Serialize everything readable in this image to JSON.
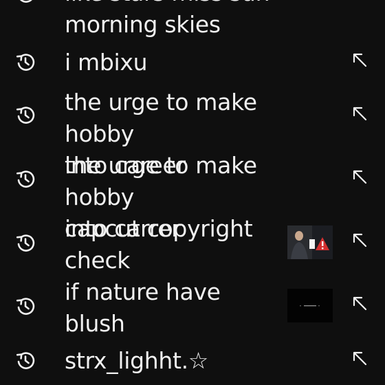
{
  "search_history": [
    {
      "query": "like stars miss sun\nmorning skies",
      "has_thumbnail": false
    },
    {
      "query": "i mbixu",
      "has_thumbnail": false
    },
    {
      "query": "the urge to make hobby\ninto career",
      "has_thumbnail": false
    },
    {
      "query": "the urge to make hobby\ninto carrer",
      "has_thumbnail": false
    },
    {
      "query": "capcut copyright\ncheck",
      "has_thumbnail": true
    },
    {
      "query": "if nature have\nblush",
      "has_thumbnail": true
    },
    {
      "query": "strx_lighht.☆",
      "has_thumbnail": false
    }
  ],
  "icons": {
    "history": "history-icon",
    "fill_query": "arrow-up-left-icon"
  },
  "colors": {
    "background": "#0f0f0f",
    "text": "#f1f1f1",
    "thumb_warning": "#d32f2f"
  }
}
